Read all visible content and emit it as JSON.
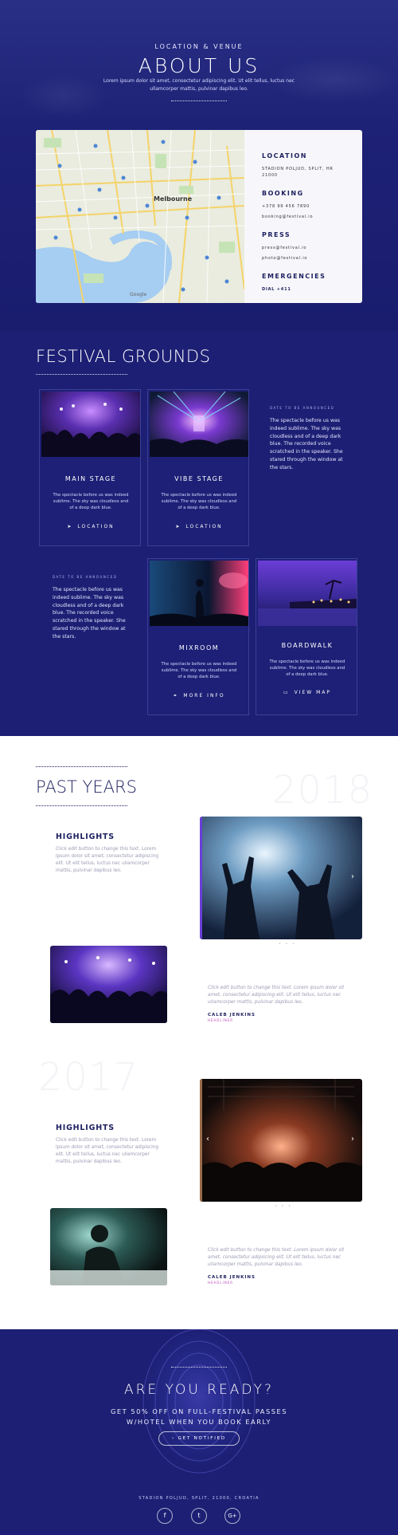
{
  "about": {
    "eyebrow": "LOCATION & VENUE",
    "title": "ABOUT US",
    "subtitle": "Lorem ipsum dolor sit amet, consectetur adipiscing elit. Ut elit tellus, luctus nec ullamcorper mattis, pulvinar dapibus leo.",
    "map_credit": "Google",
    "map_city": "Melbourne",
    "location": {
      "heading": "LOCATION",
      "lines": [
        "STADION POLJUD, SPLIT, HR",
        "21000"
      ]
    },
    "booking": {
      "heading": "BOOKING",
      "lines": [
        "+378 99 456 7890",
        "booking@festival.io"
      ]
    },
    "press": {
      "heading": "PRESS",
      "lines": [
        "press@festival.io",
        "photo@festival.io"
      ]
    },
    "emergencies": {
      "heading": "EMERGENCIES",
      "lines": [
        "DIAL +411"
      ]
    }
  },
  "grounds": {
    "title": "FESTIVAL GROUNDS",
    "cards": [
      {
        "title": "MAIN STAGE",
        "text": "The spectacle before us was indeed sublime. The sky was cloudless and of a deep dark blue.",
        "action": "LOCATION",
        "icon": "location-arrow-icon"
      },
      {
        "title": "VIBE STAGE",
        "text": "The spectacle before us was indeed sublime. The sky was cloudless and of a deep dark blue.",
        "action": "LOCATION",
        "icon": "location-arrow-icon"
      },
      {
        "title": "MIXROOM",
        "text": "The spectacle before us was indeed sublime. The sky was cloudless and of a deep dark blue.",
        "action": "MORE INFO",
        "icon": "link-icon"
      },
      {
        "title": "BOARDWALK",
        "text": "The spectacle before us was indeed sublime. The sky was cloudless and of a deep dark blue.",
        "action": "VIEW MAP",
        "icon": "map-icon"
      }
    ],
    "announce": [
      {
        "tag": "DATE TO BE ANNOUNCED",
        "text": "The spectacle before us was indeed sublime. The sky was cloudless and of a deep dark blue. The recorded voice scratched in the speaker. She stared through the window at the stars."
      },
      {
        "tag": "DATE TO BE ANNOUNCED",
        "text": "The spectacle before us was indeed sublime. The sky was cloudless and of a deep dark blue. The recorded voice scratched in the speaker. She stared through the window at the stars."
      }
    ]
  },
  "past": {
    "title": "PAST YEARS",
    "years": [
      "2018",
      "2017"
    ],
    "highlights": [
      {
        "title": "HIGHLIGHTS",
        "text": "Click edit button to change this text. Lorem ipsum dolor sit amet, consectetur adipiscing elit. Ut elit tellus, luctus nec ullamcorper mattis, pulvinar dapibus leo."
      },
      {
        "title": "HIGHLIGHTS",
        "text": "Click edit button to change this text. Lorem ipsum dolor sit amet, consectetur adipiscing elit. Ut elit tellus, luctus nec ullamcorper mattis, pulvinar dapibus leo."
      }
    ],
    "quotes": [
      {
        "text": "Click edit button to change this text. Lorem ipsum dolor sit amet, consectetur adipiscing elit. Ut elit tellus, luctus nec ullamcorper mattis, pulvinar dapibus leo.",
        "name": "CALEB JENKINS",
        "role": "HEADLINER"
      },
      {
        "text": "Click edit button to change this text. Lorem ipsum dolor sit amet, consectetur adipiscing elit. Ut elit tellus, luctus nec ullamcorper mattis, pulvinar dapibus leo.",
        "name": "CALEB JENKINS",
        "role": "HEADLINER"
      }
    ]
  },
  "cta": {
    "title": "ARE YOU READY?",
    "sub_line1": "GET 50% OFF ON FULL-FESTIVAL PASSES",
    "sub_line2": "W/HOTEL WHEN YOU BOOK EARLY",
    "button": "GET NOTIFIED",
    "address": "STADION POLJUD, SPLIT, 21000, CROATIA",
    "social": [
      {
        "icon": "facebook-icon",
        "glyph": "f"
      },
      {
        "icon": "twitter-icon",
        "glyph": "t"
      },
      {
        "icon": "google-plus-icon",
        "glyph": "G+"
      }
    ]
  },
  "colors": {
    "navy": "#1c1f73",
    "accent": "#c347c0",
    "white": "#ffffff"
  }
}
